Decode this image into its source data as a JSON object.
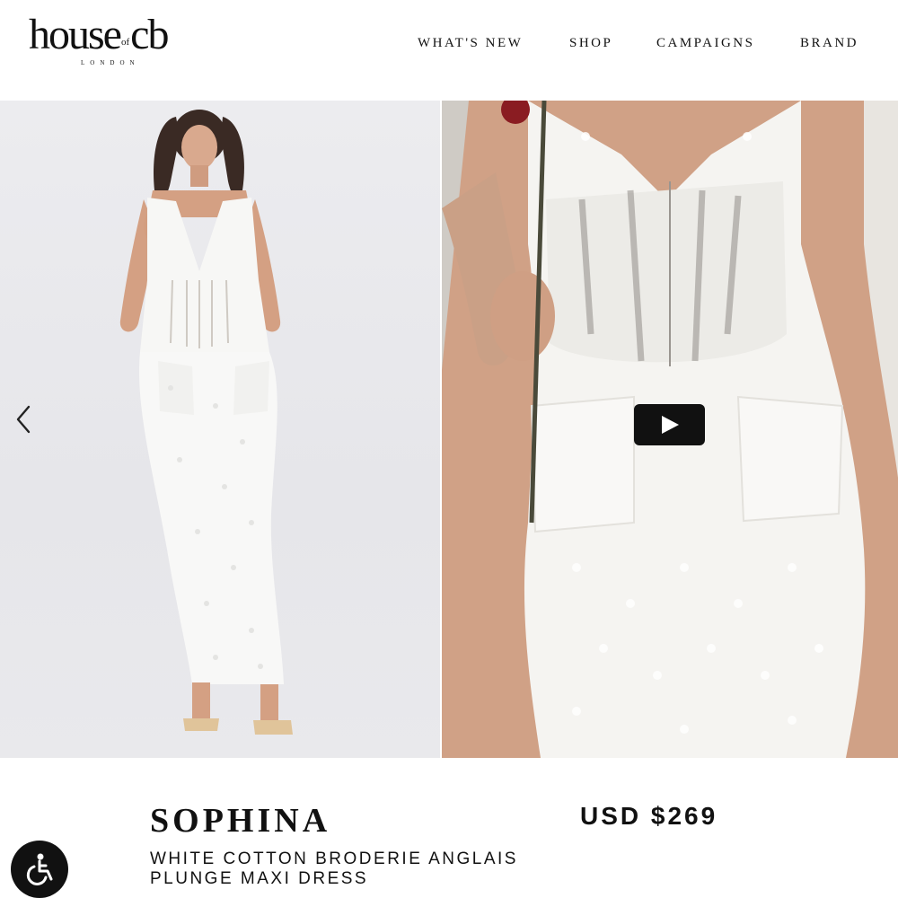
{
  "brand": {
    "logo_left": "house",
    "logo_of": "of",
    "logo_right": "cb",
    "logo_sub": "LONDON"
  },
  "nav": {
    "whats_new": "WHAT'S NEW",
    "shop": "SHOP",
    "campaigns": "CAMPAIGNS",
    "brand": "BRAND"
  },
  "gallery": {
    "prev_icon": "chevron-left-icon",
    "play_icon": "play-icon",
    "left_background": "#e8e8eb",
    "right_background": "#dedad4"
  },
  "product": {
    "name": "SOPHINA",
    "subtitle_line1": "WHITE COTTON BRODERIE ANGLAIS",
    "subtitle_line2": "PLUNGE MAXI DRESS",
    "price": "USD $269"
  },
  "accessibility": {
    "icon": "wheelchair-icon"
  }
}
